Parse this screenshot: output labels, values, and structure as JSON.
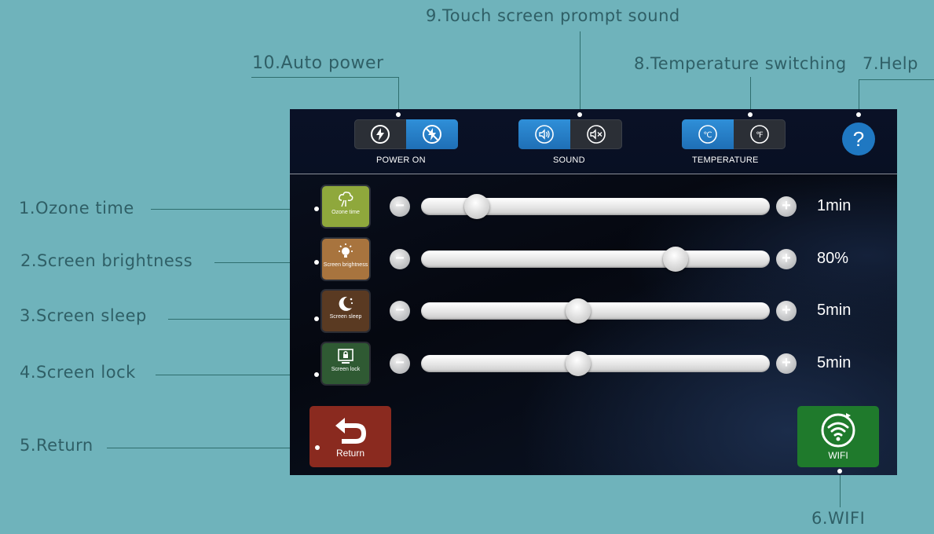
{
  "callouts": {
    "c1": "1.Ozone time",
    "c2": "2.Screen brightness",
    "c3": "3.Screen sleep",
    "c4": "4.Screen lock",
    "c5": "5.Return",
    "c6": "6.WIFI",
    "c7": "7.Help",
    "c8": "8.Temperature switching",
    "c9": "9.Touch screen prompt sound",
    "c10": "10.Auto power"
  },
  "topbar": {
    "power": {
      "label": "POWER ON",
      "selected": "off",
      "icons": [
        "power-on-icon",
        "power-off-icon"
      ]
    },
    "sound": {
      "label": "SOUND",
      "selected": "on",
      "icons": [
        "speaker-on-icon",
        "speaker-mute-icon"
      ]
    },
    "temperature": {
      "label": "TEMPERATURE",
      "options": [
        "℃",
        "℉"
      ],
      "selected": "℃"
    },
    "help": {
      "label": "?"
    }
  },
  "settings": [
    {
      "name": "Ozone time",
      "icon_label": "Ozone time",
      "value": "1min",
      "level": 0.16,
      "color": "#8fa83c",
      "icon": "ozone-icon"
    },
    {
      "name": "Screen brightness",
      "icon_label": "Screen brightness",
      "value": "80%",
      "level": 0.73,
      "color": "#a8743e",
      "icon": "brightness-icon"
    },
    {
      "name": "Screen sleep",
      "icon_label": "Screen sleep",
      "value": "5min",
      "level": 0.45,
      "color": "#5a3a22",
      "icon": "moon-icon"
    },
    {
      "name": "Screen lock",
      "icon_label": "Screen lock",
      "value": "5min",
      "level": 0.45,
      "color": "#2f5a33",
      "icon": "lock-icon"
    }
  ],
  "buttons": {
    "return": {
      "label": "Return",
      "color": "#8a2a1f"
    },
    "wifi": {
      "label": "WIFI",
      "color": "#1f7a2c"
    }
  },
  "colors": {
    "background": "#6fb3bb",
    "accent_blue": "#1f78c2",
    "callout_text": "#2f5f66"
  }
}
